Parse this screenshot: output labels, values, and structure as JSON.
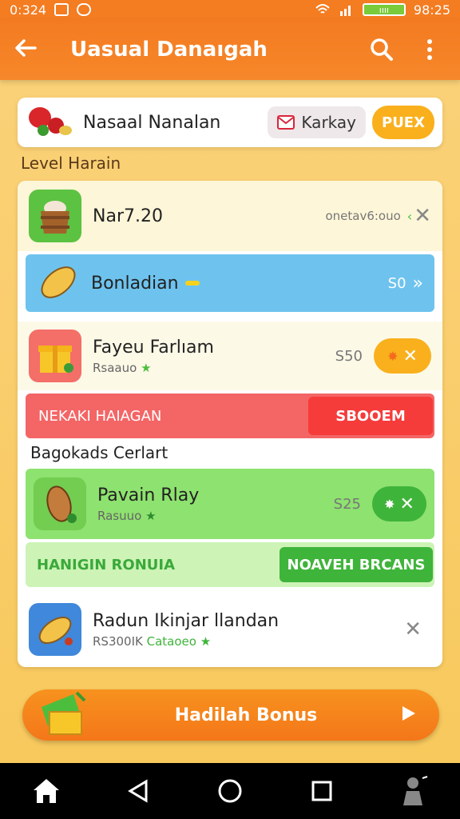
{
  "status": {
    "left_time": "0:324",
    "right_time": "98:25",
    "battery_text": "ıııı"
  },
  "appbar": {
    "title": "Uasual Danaıgah",
    "back_icon": "arrow-left-icon",
    "search_icon": "search-icon",
    "menu_icon": "more-vertical-icon"
  },
  "header_card": {
    "name": "Nasaal Nanalan",
    "chip_label": "Karkay",
    "button_label": "PUEX"
  },
  "section1": {
    "label": "Level Harain"
  },
  "rows": [
    {
      "title": "Nar7.20",
      "meta": "onetav6:ouo"
    },
    {
      "title": "Bonladian",
      "price": "S0"
    },
    {
      "title": "Fayeu Farlıam",
      "sub": "Rsaauo",
      "price": "S50"
    }
  ],
  "banner_red": {
    "left": "NEKAKI HAIAGAN",
    "right": "SBOOEM"
  },
  "section2": {
    "label": "Bagokads Cerlart"
  },
  "row_green": {
    "title": "Pavain Rlay",
    "sub": "Rasuuo",
    "price": "S25"
  },
  "banner_green": {
    "left": "HANIGIN RONUIA",
    "right": "NOAVEH BRCANS"
  },
  "row_last": {
    "title": "Radun Ikinjar llandan",
    "sub": "RS300IK",
    "sub_green": "Cataoeo"
  },
  "bonus": {
    "label": "Hadilah Bonus"
  },
  "colors": {
    "accent": "#f47c21",
    "green": "#4cbe3d",
    "red": "#f54242",
    "blue": "#6ec3ee"
  }
}
